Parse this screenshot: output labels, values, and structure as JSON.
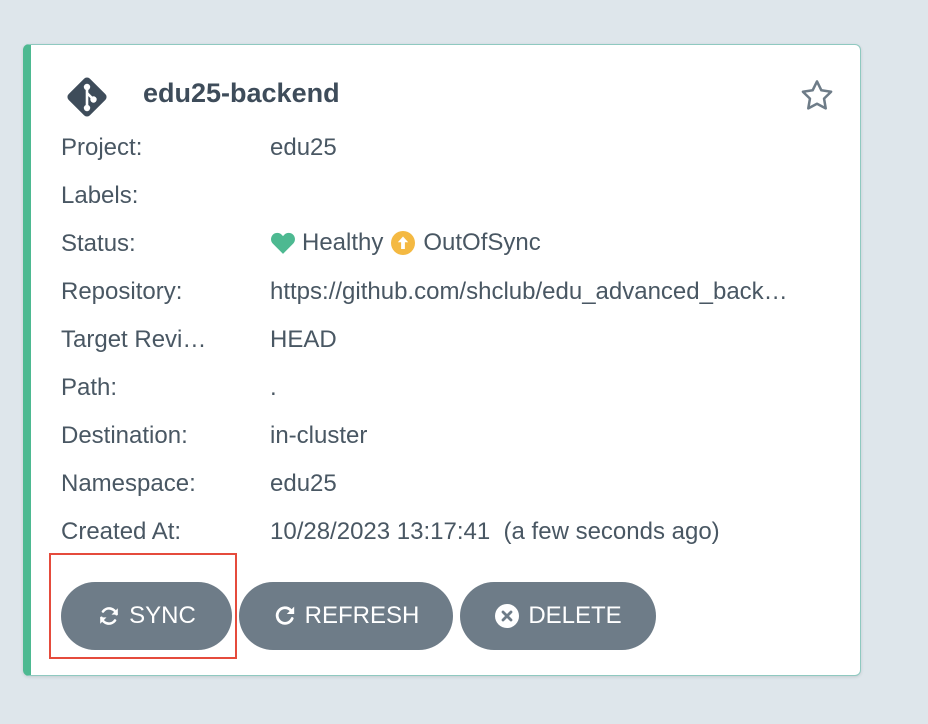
{
  "app": {
    "name": "edu25-backend",
    "health_color": "#4db991",
    "sync_color": "#f4b942"
  },
  "rows": {
    "project": {
      "label": "Project:",
      "value": "edu25"
    },
    "labels": {
      "label": "Labels:",
      "value": ""
    },
    "status": {
      "label": "Status:",
      "health": "Healthy",
      "sync": "OutOfSync"
    },
    "repository": {
      "label": "Repository:",
      "value": "https://github.com/shclub/edu_advanced_back…"
    },
    "target_revision": {
      "label": "Target Revi…",
      "value": "HEAD"
    },
    "path": {
      "label": "Path:",
      "value": "."
    },
    "destination": {
      "label": "Destination:",
      "value": "in-cluster"
    },
    "namespace": {
      "label": "Namespace:",
      "value": "edu25"
    },
    "created_at": {
      "label": "Created At:",
      "value": "10/28/2023 13:17:41  (a few seconds ago)"
    }
  },
  "actions": {
    "sync_label": "SYNC",
    "refresh_label": "REFRESH",
    "delete_label": "DELETE"
  },
  "icons": [
    "git-icon",
    "star-icon",
    "heart-icon",
    "arrow-up-circle-icon",
    "sync-icon",
    "refresh-icon",
    "delete-circle-icon"
  ]
}
